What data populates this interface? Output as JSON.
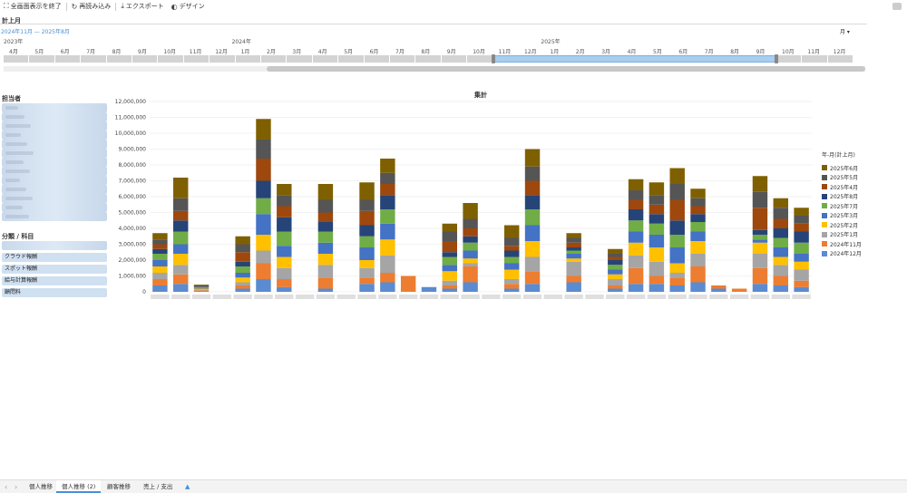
{
  "toolbar": {
    "fullscreen_label": "全画面表示を終了",
    "reload_label": "再読み込み",
    "export_label": "エクスポート",
    "design_label": "デザイン"
  },
  "timeline": {
    "title": "計上月",
    "range_label": "2024年11月 — 2025年8月",
    "granularity": "月 ▾",
    "years": [
      "2023年",
      "2024年",
      "2025年"
    ],
    "months": [
      "4月",
      "5月",
      "6月",
      "7月",
      "8月",
      "9月",
      "10月",
      "11月",
      "12月",
      "1月",
      "2月",
      "3月",
      "4月",
      "5月",
      "6月",
      "7月",
      "8月",
      "9月",
      "10月",
      "11月",
      "12月",
      "1月",
      "2月",
      "3月",
      "4月",
      "5月",
      "6月",
      "7月",
      "8月",
      "9月",
      "10月",
      "11月",
      "12月"
    ],
    "selected_start_index": 19,
    "selected_end_index": 29
  },
  "sidebar": {
    "owner_title": "担当者",
    "category_title": "分類 / 科目",
    "category_items": [
      "クラウド報酬",
      "スポット報酬",
      "給与計算報酬",
      "顧問料"
    ]
  },
  "chart_data": {
    "type": "bar",
    "stacked": true,
    "title": "集計",
    "ylim": [
      0,
      12000000
    ],
    "yticks": [
      0,
      1000000,
      2000000,
      3000000,
      4000000,
      5000000,
      6000000,
      7000000,
      8000000,
      9000000,
      10000000,
      11000000,
      12000000
    ],
    "ytick_labels": [
      "0",
      "1,000,000",
      "2,000,000",
      "3,000,000",
      "4,000,000",
      "5,000,000",
      "6,000,000",
      "7,000,000",
      "8,000,000",
      "9,000,000",
      "10,000,000",
      "11,000,000",
      "12,000,000"
    ],
    "grid": true,
    "legend_position": "right",
    "legend_title": "年-月(計上月)",
    "series": [
      {
        "name": "2024年12月",
        "color": "#5b8bd0",
        "values": [
          400000,
          500000,
          50000,
          0,
          200000,
          800000,
          300000,
          0,
          200000,
          0,
          500000,
          600000,
          0,
          300000,
          200000,
          600000,
          0,
          200000,
          500000,
          0,
          600000,
          0,
          200000,
          500000,
          500000,
          400000,
          600000,
          200000,
          0,
          500000,
          400000,
          300000
        ]
      },
      {
        "name": "2024年11月",
        "color": "#ed7d31",
        "values": [
          400000,
          600000,
          50000,
          0,
          200000,
          1000000,
          500000,
          0,
          700000,
          0,
          400000,
          600000,
          1000000,
          0,
          200000,
          1000000,
          0,
          300000,
          800000,
          0,
          400000,
          0,
          200000,
          1000000,
          500000,
          500000,
          1000000,
          200000,
          200000,
          1000000,
          600000,
          400000
        ]
      },
      {
        "name": "2025年1月",
        "color": "#a5a5a5",
        "values": [
          400000,
          600000,
          50000,
          0,
          200000,
          800000,
          700000,
          0,
          800000,
          0,
          600000,
          1100000,
          0,
          0,
          300000,
          200000,
          0,
          300000,
          900000,
          0,
          900000,
          0,
          400000,
          800000,
          900000,
          300000,
          800000,
          0,
          0,
          900000,
          700000,
          700000
        ]
      },
      {
        "name": "2025年2月",
        "color": "#ffc000",
        "values": [
          400000,
          700000,
          50000,
          0,
          300000,
          1000000,
          700000,
          0,
          700000,
          0,
          500000,
          1000000,
          0,
          0,
          600000,
          300000,
          0,
          600000,
          1000000,
          0,
          200000,
          0,
          300000,
          800000,
          900000,
          600000,
          800000,
          0,
          0,
          700000,
          500000,
          500000
        ]
      },
      {
        "name": "2025年3月",
        "color": "#4472c4",
        "values": [
          400000,
          600000,
          50000,
          0,
          300000,
          1300000,
          700000,
          0,
          700000,
          0,
          800000,
          1000000,
          0,
          0,
          400000,
          500000,
          0,
          400000,
          1000000,
          0,
          300000,
          0,
          300000,
          700000,
          800000,
          1000000,
          600000,
          0,
          0,
          200000,
          600000,
          500000
        ]
      },
      {
        "name": "2025年7月",
        "color": "#70ad47",
        "values": [
          400000,
          800000,
          50000,
          0,
          400000,
          1000000,
          900000,
          0,
          700000,
          0,
          700000,
          900000,
          0,
          0,
          500000,
          500000,
          0,
          400000,
          1000000,
          0,
          200000,
          0,
          300000,
          700000,
          700000,
          800000,
          600000,
          0,
          0,
          300000,
          600000,
          700000
        ]
      },
      {
        "name": "2025年8月",
        "color": "#264478",
        "values": [
          300000,
          700000,
          40000,
          0,
          300000,
          1100000,
          900000,
          0,
          600000,
          0,
          700000,
          900000,
          0,
          0,
          300000,
          400000,
          0,
          400000,
          900000,
          0,
          200000,
          0,
          300000,
          700000,
          600000,
          900000,
          500000,
          0,
          0,
          300000,
          600000,
          700000
        ]
      },
      {
        "name": "2025年4月",
        "color": "#9e480e",
        "values": [
          300000,
          600000,
          30000,
          0,
          600000,
          1400000,
          700000,
          0,
          600000,
          0,
          900000,
          700000,
          0,
          0,
          700000,
          500000,
          0,
          300000,
          900000,
          0,
          300000,
          0,
          200000,
          600000,
          600000,
          1300000,
          500000,
          0,
          0,
          1400000,
          600000,
          500000
        ]
      },
      {
        "name": "2025年5月",
        "color": "#555555",
        "values": [
          300000,
          800000,
          30000,
          0,
          500000,
          1200000,
          700000,
          0,
          800000,
          0,
          700000,
          700000,
          0,
          0,
          600000,
          600000,
          0,
          500000,
          900000,
          0,
          300000,
          0,
          200000,
          600000,
          600000,
          1000000,
          500000,
          0,
          0,
          1000000,
          700000,
          500000
        ]
      },
      {
        "name": "2025年6月",
        "color": "#7f6000",
        "values": [
          400000,
          1300000,
          50000,
          0,
          500000,
          1300000,
          700000,
          0,
          1000000,
          0,
          1100000,
          900000,
          0,
          0,
          500000,
          1000000,
          0,
          800000,
          1100000,
          0,
          300000,
          0,
          300000,
          700000,
          800000,
          1000000,
          600000,
          0,
          0,
          1000000,
          600000,
          500000
        ]
      }
    ],
    "bar_total_overrides_note": ""
  }
}
